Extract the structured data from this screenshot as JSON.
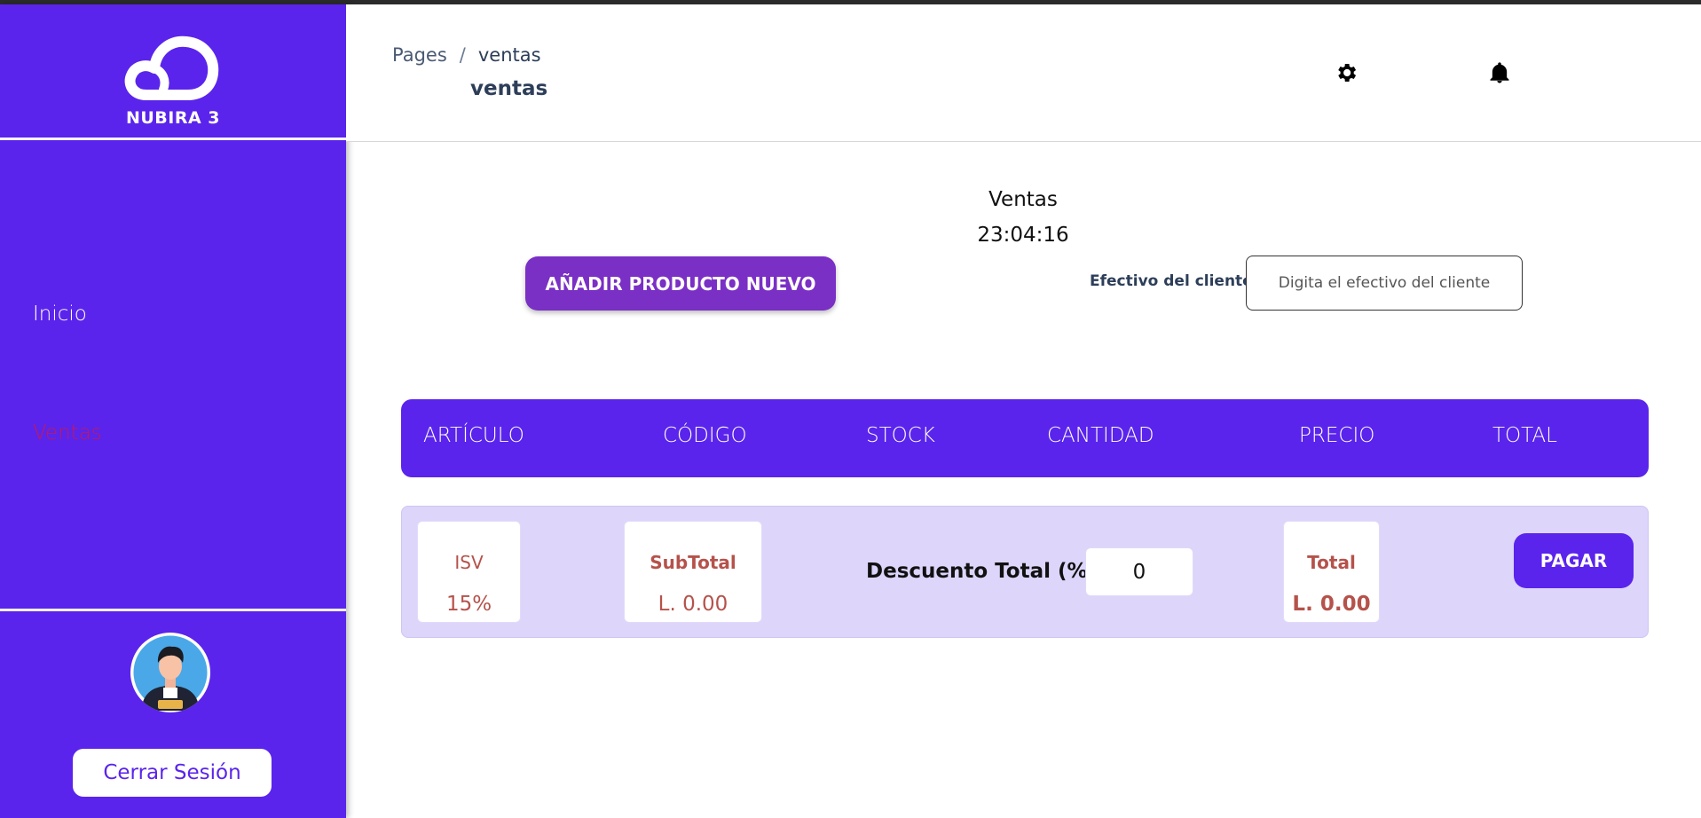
{
  "brand": {
    "logo_text": "NUBIRA 3"
  },
  "sidebar": {
    "items": [
      {
        "label": "Inicio"
      },
      {
        "label": "Ventas"
      }
    ],
    "logout_label": "Cerrar Sesión"
  },
  "header": {
    "breadcrumb": [
      "Pages",
      "ventas"
    ],
    "title": "ventas",
    "icons": [
      "gear-icon",
      "bell-icon"
    ]
  },
  "main": {
    "title": "Ventas",
    "clock": "23:04:16",
    "add_product_label": "AÑADIR PRODUCTO NUEVO",
    "cash": {
      "label": "Efectivo del cliente:",
      "placeholder": "Digita el efectivo del cliente",
      "value": ""
    },
    "table": {
      "columns": [
        "ARTÍCULO",
        "CÓDIGO",
        "STOCK",
        "CANTIDAD",
        "PRECIO",
        "TOTAL"
      ]
    },
    "summary": {
      "isv_label": "ISV",
      "isv_value": "15%",
      "subtotal_label": "SubTotal",
      "subtotal_value": "L. 0.00",
      "discount_label": "Descuento Total (%):",
      "discount_value": "0",
      "total_label": "Total",
      "total_value": "L. 0.00",
      "pay_label": "PAGAR"
    }
  },
  "colors": {
    "primary": "#5a24ec",
    "accent_button": "#7a2fc5",
    "summary_bg": "#ddd5fa",
    "summary_text": "#b5524b",
    "active_nav": "#c2185b"
  }
}
